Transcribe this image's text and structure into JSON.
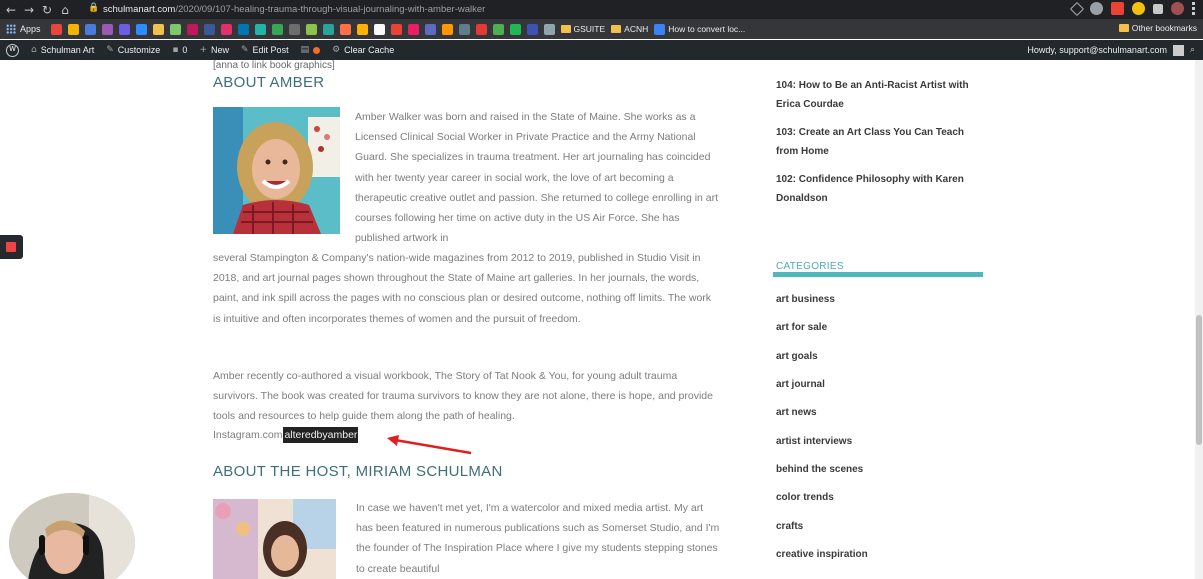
{
  "browser": {
    "url_host": "schulmanart.com",
    "url_path": "/2020/09/107-healing-trauma-through-visual-journaling-with-amber-walker",
    "nav_back": "←",
    "nav_forward": "→",
    "nav_reload": "↻",
    "nav_home": "⌂",
    "lock": "🔒"
  },
  "bookmarks": {
    "apps_label": "Apps",
    "gsuite_label": "GSUITE",
    "acnh_label": "ACNH",
    "convert_label": "How to convert loc...",
    "other_label": "Other bookmarks",
    "icon_colors": [
      "#e8453c",
      "#f4b400",
      "#4a7bdc",
      "#9b59b6",
      "#6c5ce7",
      "#2d8cff",
      "#f2c04d",
      "#7bc96f",
      "#c2185b",
      "#3b5998",
      "#e1306c",
      "#0077b5",
      "#1fb6a6",
      "#34a853",
      "#6d6d6d",
      "#8bc34a",
      "#26a69a",
      "#ff7043",
      "#ffb300",
      "#fafafa",
      "#ea4335",
      "#e91e63",
      "#5c6bc0",
      "#ff9800",
      "#607d8b",
      "#e53935",
      "#4caf50",
      "#1db954",
      "#3f51b5",
      "#90a4ae"
    ]
  },
  "wpbar": {
    "site_label": "Schulman Art",
    "customize_label": "Customize",
    "comments_count": "0",
    "new_label": "New",
    "edit_label": "Edit Post",
    "cache_label": "Clear Cache",
    "howdy_label": "Howdy, support@schulmanart.com"
  },
  "article": {
    "pre_note": "[anna to link book graphics]",
    "about_heading": "ABOUT AMBER",
    "bio_part1": "Amber Walker was born and raised in the State of Maine. She works as a Licensed Clinical Social Worker in Private Practice and the Army National Guard. She specializes in trauma treatment. Her art journaling has coincided with her twenty year career in social work, the love of art becoming a therapeutic creative outlet and passion. She returned to college enrolling in art courses following her time on active duty in the US Air Force. She has published artwork in",
    "bio_part2": "several Stampington & Company's nation-wide magazines from 2012 to 2019, published in Studio Visit in 2018, and art journal pages shown throughout the State of Maine art galleries. In her journals, the words, paint, and ink spill across the pages with no conscious plan or desired outcome, nothing off limits. The work is intuitive and often incorporates themes of women and the pursuit of freedom.",
    "bio_para2": "Amber recently co-authored a visual workbook, The Story of Tat Nook & You, for young adult trauma survivors. The book was created for trauma survivors to know they are not alone, there is hope, and provide tools and resources to help guide them along the path of healing.",
    "instagram_prefix": "Instagram.com",
    "instagram_handle": "alteredbyamber",
    "host_heading": "ABOUT THE HOST, MIRIAM SCHULMAN",
    "host_text": "In case we haven't met yet, I'm a watercolor and mixed media artist. My art has been featured in numerous publications such as Somerset Studio, and I'm the founder of The Inspiration Place  where I give my students stepping stones to create beautiful"
  },
  "sidebar": {
    "posts": [
      "104: How to Be an Anti-Racist Artist with Erica Courdae",
      "103: Create an Art Class You Can Teach from Home",
      "102: Confidence Philosophy with Karen Donaldson"
    ],
    "categories_heading": "CATEGORIES",
    "categories": [
      "art business",
      "art for sale",
      "art goals",
      "art journal",
      "art news",
      "artist interviews",
      "behind the scenes",
      "color trends",
      "crafts",
      "creative inspiration"
    ]
  },
  "colors": {
    "accent": "#4fb8bc",
    "heading": "#3d6f7a",
    "annotation_arrow": "#e02020"
  }
}
